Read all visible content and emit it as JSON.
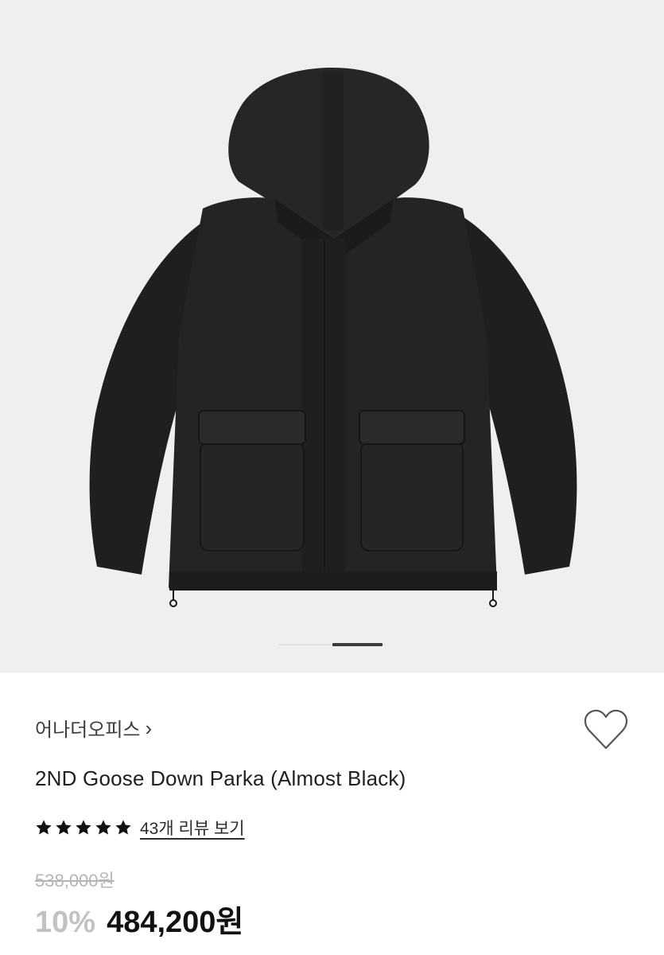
{
  "product": {
    "brand": "어나더오피스",
    "brand_chevron": "›",
    "title": "2ND Goose Down Parka (Almost Black)",
    "rating_stars": 5,
    "review_link": "43개 리뷰 보기",
    "original_price": "538,000원",
    "discount": "10%",
    "final_price": "484,200원"
  },
  "icons": {
    "wishlist": "heart-outline-icon",
    "star": "star-icon"
  },
  "colors": {
    "gallery_bg": "#efefef",
    "jacket": "#222222",
    "discount": "#c2c2c2",
    "strike_price": "#b5b5b5"
  }
}
